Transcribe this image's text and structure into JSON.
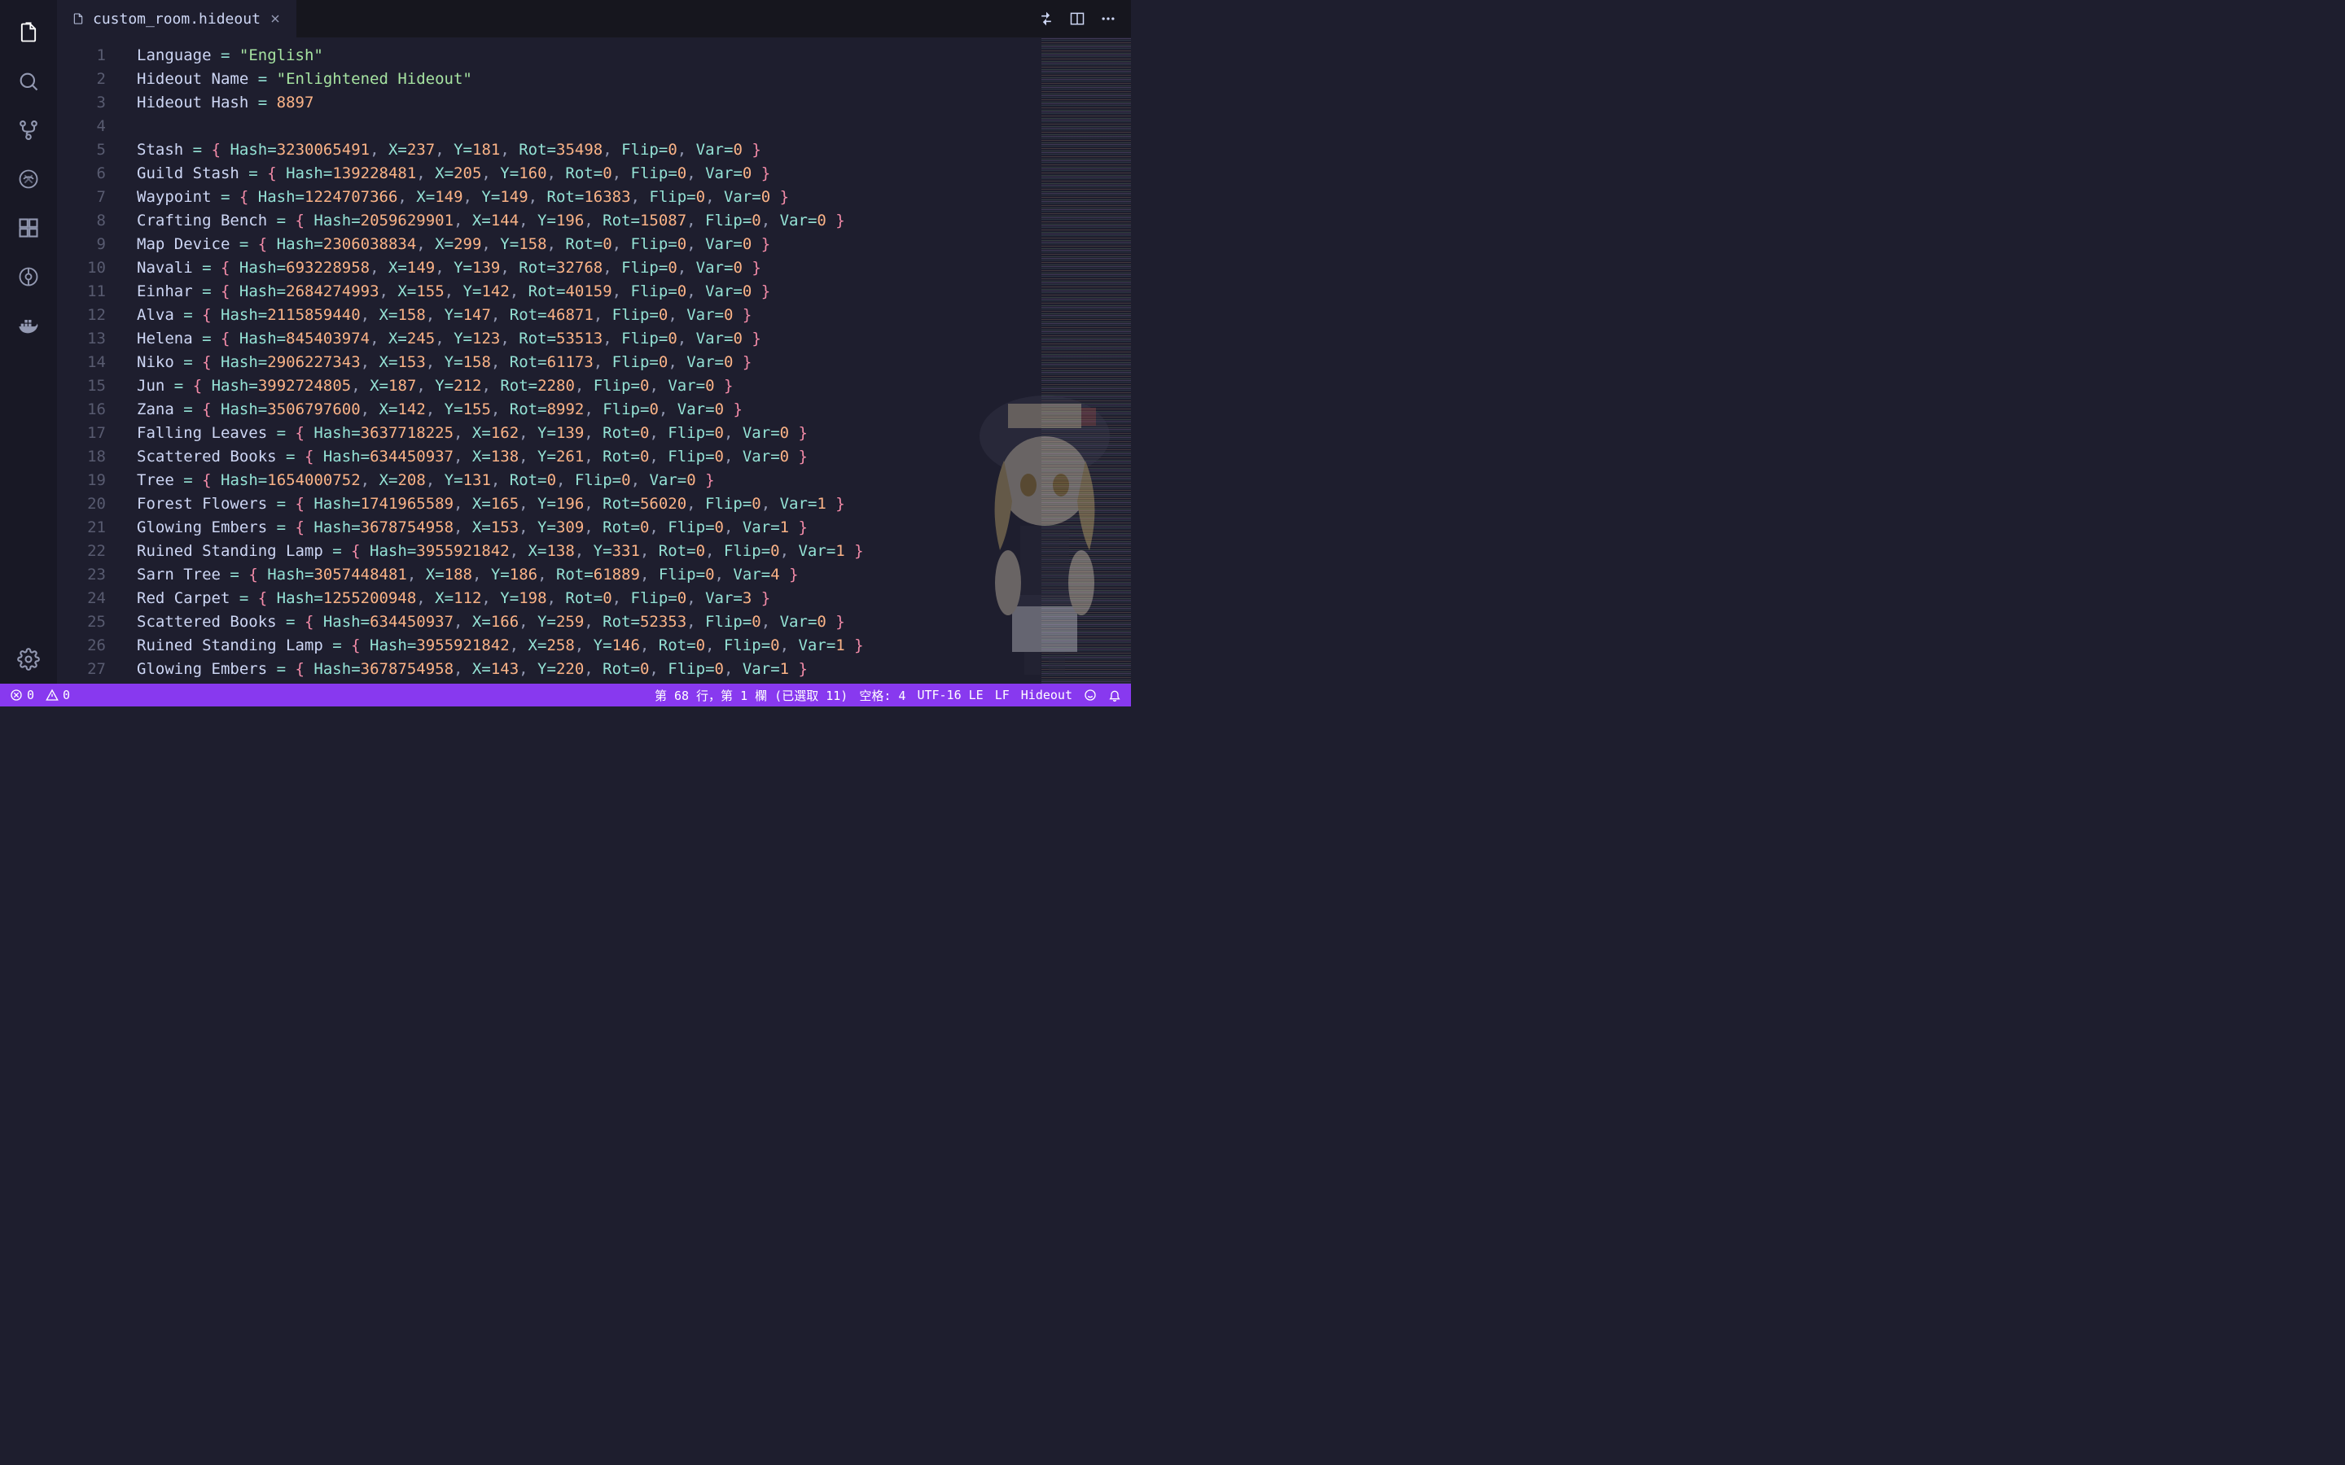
{
  "tab": {
    "filename": "custom_room.hideout"
  },
  "code": {
    "header": [
      {
        "label": "Language",
        "value": "\"English\""
      },
      {
        "label": "Hideout Name",
        "value": "\"Enlightened Hideout\""
      },
      {
        "label": "Hideout Hash",
        "value": "8897"
      }
    ],
    "entries": [
      {
        "name": "Stash",
        "hash": "3230065491",
        "x": "237",
        "y": "181",
        "rot": "35498",
        "flip": "0",
        "var": "0"
      },
      {
        "name": "Guild Stash",
        "hash": "139228481",
        "x": "205",
        "y": "160",
        "rot": "0",
        "flip": "0",
        "var": "0"
      },
      {
        "name": "Waypoint",
        "hash": "1224707366",
        "x": "149",
        "y": "149",
        "rot": "16383",
        "flip": "0",
        "var": "0"
      },
      {
        "name": "Crafting Bench",
        "hash": "2059629901",
        "x": "144",
        "y": "196",
        "rot": "15087",
        "flip": "0",
        "var": "0"
      },
      {
        "name": "Map Device",
        "hash": "2306038834",
        "x": "299",
        "y": "158",
        "rot": "0",
        "flip": "0",
        "var": "0"
      },
      {
        "name": "Navali",
        "hash": "693228958",
        "x": "149",
        "y": "139",
        "rot": "32768",
        "flip": "0",
        "var": "0"
      },
      {
        "name": "Einhar",
        "hash": "2684274993",
        "x": "155",
        "y": "142",
        "rot": "40159",
        "flip": "0",
        "var": "0"
      },
      {
        "name": "Alva",
        "hash": "2115859440",
        "x": "158",
        "y": "147",
        "rot": "46871",
        "flip": "0",
        "var": "0"
      },
      {
        "name": "Helena",
        "hash": "845403974",
        "x": "245",
        "y": "123",
        "rot": "53513",
        "flip": "0",
        "var": "0"
      },
      {
        "name": "Niko",
        "hash": "2906227343",
        "x": "153",
        "y": "158",
        "rot": "61173",
        "flip": "0",
        "var": "0"
      },
      {
        "name": "Jun",
        "hash": "3992724805",
        "x": "187",
        "y": "212",
        "rot": "2280",
        "flip": "0",
        "var": "0"
      },
      {
        "name": "Zana",
        "hash": "3506797600",
        "x": "142",
        "y": "155",
        "rot": "8992",
        "flip": "0",
        "var": "0"
      },
      {
        "name": "Falling Leaves",
        "hash": "3637718225",
        "x": "162",
        "y": "139",
        "rot": "0",
        "flip": "0",
        "var": "0"
      },
      {
        "name": "Scattered Books",
        "hash": "634450937",
        "x": "138",
        "y": "261",
        "rot": "0",
        "flip": "0",
        "var": "0"
      },
      {
        "name": "Tree",
        "hash": "1654000752",
        "x": "208",
        "y": "131",
        "rot": "0",
        "flip": "0",
        "var": "0"
      },
      {
        "name": "Forest Flowers",
        "hash": "1741965589",
        "x": "165",
        "y": "196",
        "rot": "56020",
        "flip": "0",
        "var": "1"
      },
      {
        "name": "Glowing Embers",
        "hash": "3678754958",
        "x": "153",
        "y": "309",
        "rot": "0",
        "flip": "0",
        "var": "1"
      },
      {
        "name": "Ruined Standing Lamp",
        "hash": "3955921842",
        "x": "138",
        "y": "331",
        "rot": "0",
        "flip": "0",
        "var": "1"
      },
      {
        "name": "Sarn Tree",
        "hash": "3057448481",
        "x": "188",
        "y": "186",
        "rot": "61889",
        "flip": "0",
        "var": "4"
      },
      {
        "name": "Red Carpet",
        "hash": "1255200948",
        "x": "112",
        "y": "198",
        "rot": "0",
        "flip": "0",
        "var": "3"
      },
      {
        "name": "Scattered Books",
        "hash": "634450937",
        "x": "166",
        "y": "259",
        "rot": "52353",
        "flip": "0",
        "var": "0"
      },
      {
        "name": "Ruined Standing Lamp",
        "hash": "3955921842",
        "x": "258",
        "y": "146",
        "rot": "0",
        "flip": "0",
        "var": "1"
      },
      {
        "name": "Glowing Embers",
        "hash": "3678754958",
        "x": "143",
        "y": "220",
        "rot": "0",
        "flip": "0",
        "var": "1"
      }
    ]
  },
  "status": {
    "errors": "0",
    "warnings": "0",
    "cursor": "第 68 行，第 1 欄 (已選取 11)",
    "spaces": "空格: 4",
    "encoding": "UTF-16 LE",
    "eol": "LF",
    "language": "Hideout"
  }
}
